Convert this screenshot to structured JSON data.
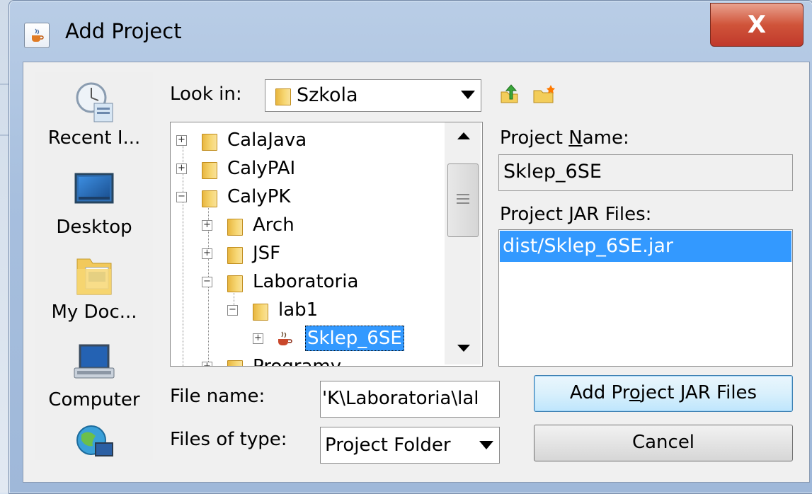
{
  "dialog": {
    "title": "Add Project",
    "close_label": "X"
  },
  "places": [
    {
      "label": "Recent I...",
      "icon": "recent-items-icon"
    },
    {
      "label": "Desktop",
      "icon": "desktop-icon"
    },
    {
      "label": "My Doc...",
      "icon": "my-documents-icon"
    },
    {
      "label": "Computer",
      "icon": "computer-icon"
    },
    {
      "label": "",
      "icon": "network-icon"
    }
  ],
  "look_in": {
    "label": "Look in:",
    "value": "Szkola"
  },
  "tree": {
    "items": [
      {
        "label": "CalaJava",
        "expander": "+",
        "icon": "folder-icon"
      },
      {
        "label": "CalyPAI",
        "expander": "+",
        "icon": "folder-icon"
      },
      {
        "label": "CalyPK",
        "expander": "−",
        "icon": "folder-icon"
      },
      {
        "label": "Arch",
        "expander": "+",
        "icon": "folder-icon"
      },
      {
        "label": "JSF",
        "expander": "+",
        "icon": "folder-icon"
      },
      {
        "label": "Laboratoria",
        "expander": "−",
        "icon": "folder-icon"
      },
      {
        "label": "lab1",
        "expander": "−",
        "icon": "folder-icon"
      },
      {
        "label": "Sklep_6SE",
        "expander": "+",
        "icon": "java-project-icon",
        "selected": true
      },
      {
        "label": "Programy",
        "expander": "+",
        "icon": "folder-icon"
      }
    ]
  },
  "project_name": {
    "label_pre": "Project ",
    "label_mnemonic": "N",
    "label_post": "ame:",
    "value": "Sklep_6SE"
  },
  "jar_files": {
    "label_pre": "Project ",
    "label_mnemonic": "J",
    "label_post": "AR Files:",
    "items": [
      "dist/Sklep_6SE.jar"
    ]
  },
  "file_name": {
    "label": "File name:",
    "value": "'K\\Laboratoria\\lal"
  },
  "files_of_type": {
    "label": "Files of type:",
    "value": "Project Folder"
  },
  "buttons": {
    "add_jar_pre": "Add Pr",
    "add_jar_mnemonic": "o",
    "add_jar_post": "ject JAR Files",
    "cancel": "Cancel"
  }
}
